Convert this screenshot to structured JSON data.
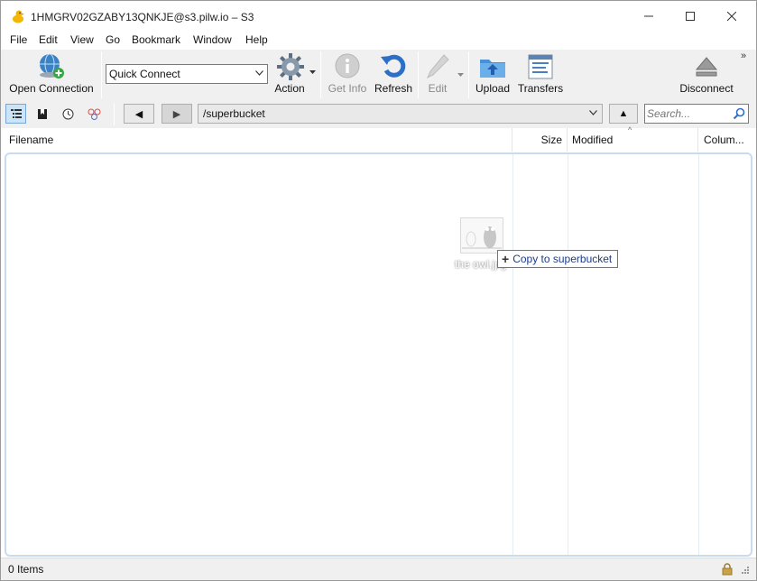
{
  "window": {
    "title": "1HMGRV02GZABY13QNKJE@s3.pilw.io – S3",
    "icons": {
      "app": "duck-icon",
      "minimize": "minimize-icon",
      "maximize": "maximize-icon",
      "close": "close-icon"
    }
  },
  "menu": {
    "items": [
      "File",
      "Edit",
      "View",
      "Go",
      "Bookmark",
      "Window",
      "Help"
    ]
  },
  "toolbar": {
    "open_connection": "Open Connection",
    "quick_connect": "Quick Connect",
    "action": "Action",
    "get_info": "Get Info",
    "refresh": "Refresh",
    "edit": "Edit",
    "upload": "Upload",
    "transfers": "Transfers",
    "disconnect": "Disconnect",
    "overflow": "»"
  },
  "navbar": {
    "views": [
      "browser-view-icon",
      "bookmarks-view-icon",
      "history-view-icon",
      "bonjour-view-icon"
    ],
    "back": "◀",
    "forward": "▶",
    "path": "/superbucket",
    "up": "▲",
    "search_placeholder": "Search..."
  },
  "columns": {
    "filename": "Filename",
    "size": "Size",
    "modified": "Modified",
    "more": "Colum..."
  },
  "drag": {
    "file_label": "the owl.jpg",
    "tooltip": "Copy to superbucket"
  },
  "status": {
    "items": "0 Items"
  },
  "colors": {
    "toolbar_bg": "#f0f0f0",
    "list_border": "#c9dcef",
    "tooltip_text": "#1d3c8a"
  }
}
